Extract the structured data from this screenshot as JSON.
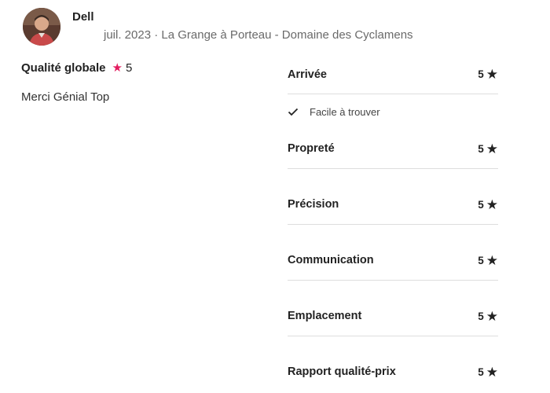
{
  "review": {
    "reviewer_name": "Dell",
    "meta": "juil. 2023 · La Grange à Porteau - Domaine des Cyclamens",
    "overall_label": "Qualité globale",
    "overall_score": "5",
    "text": "Merci Génial Top"
  },
  "ratings": {
    "arrival": {
      "label": "Arrivée",
      "score": "5",
      "note": "Facile à trouver"
    },
    "cleanliness": {
      "label": "Propreté",
      "score": "5"
    },
    "accuracy": {
      "label": "Précision",
      "score": "5"
    },
    "communication": {
      "label": "Communication",
      "score": "5"
    },
    "location": {
      "label": "Emplacement",
      "score": "5"
    },
    "value": {
      "label": "Rapport qualité-prix",
      "score": "5"
    }
  },
  "colors": {
    "overall_star": "#e31c5f",
    "divider": "#dddddd"
  },
  "icons": [
    "avatar",
    "star-icon",
    "check-icon"
  ]
}
